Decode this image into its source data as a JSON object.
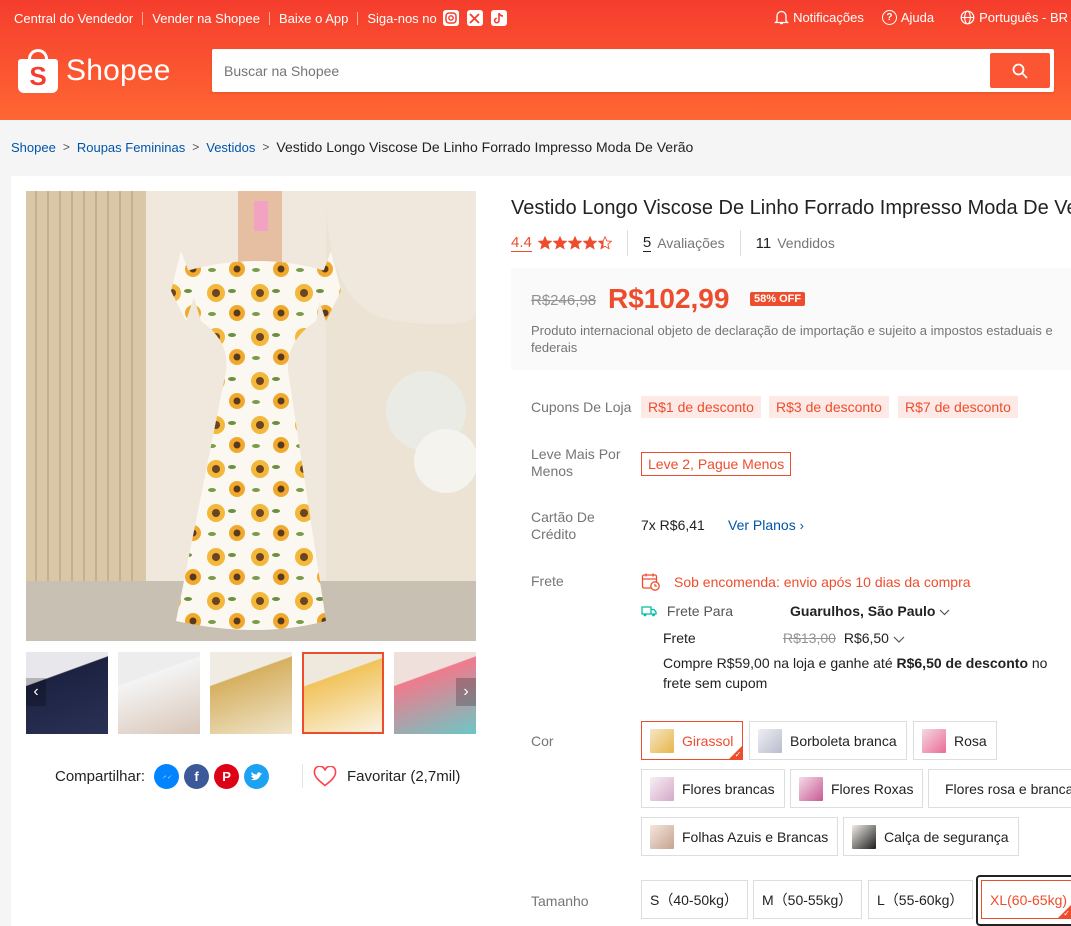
{
  "topbar": {
    "seller_center": "Central do Vendedor",
    "sell": "Vender na Shopee",
    "download": "Baixe o App",
    "follow": "Siga-nos no",
    "notifications": "Notificações",
    "help": "Ajuda",
    "language": "Português - BR"
  },
  "logo": {
    "mark": "S",
    "text": "Shopee"
  },
  "search": {
    "placeholder": "Buscar na Shopee"
  },
  "breadcrumb": {
    "items": [
      "Shopee",
      "Roupas Femininas",
      "Vestidos"
    ],
    "current": "Vestido Longo Viscose De Linho Forrado Impresso Moda De Verão"
  },
  "product": {
    "title": "Vestido Longo Viscose De Linho Forrado Impresso Moda De Verão",
    "rating": "4.4",
    "rating_value": 4.4,
    "reviews_count": "5",
    "reviews_label": "Avaliações",
    "sold_count": "11",
    "sold_label": "Vendidos",
    "old_price": "R$246,98",
    "price": "R$102,99",
    "discount": "58% OFF",
    "tax_note": "Produto internacional objeto de declaração de importação e sujeito a impostos estaduais e federais"
  },
  "coupons": {
    "label": "Cupons De Loja",
    "items": [
      "R$1 de desconto",
      "R$3 de desconto",
      "R$7 de desconto"
    ]
  },
  "promo": {
    "label": "Leve Mais Por Menos",
    "tag": "Leve 2, Pague Menos"
  },
  "credit": {
    "label": "Cartão De Crédito",
    "value": "7x R$6,41",
    "link": "Ver Planos"
  },
  "shipping": {
    "label": "Frete",
    "alert": "Sob encomenda: envio após 10 dias da compra",
    "to_label": "Frete Para",
    "to_value": "Guarulhos, São Paulo",
    "fee_label": "Frete",
    "fee_old": "R$13,00",
    "fee_new": "R$6,50",
    "note_pre": "Compre R$59,00 na loja e ganhe até ",
    "note_bold": "R$6,50 de desconto",
    "note_post": " no frete sem cupom"
  },
  "colors": {
    "label": "Cor",
    "options": [
      "Girassol",
      "Borboleta branca",
      "Rosa",
      "Flores brancas",
      "Flores Roxas",
      "Flores rosa e brancas",
      "Folhas Azuis e Brancas",
      "Calça de segurança"
    ],
    "selected": "Girassol"
  },
  "sizes": {
    "label": "Tamanho",
    "options": [
      "S（40-50kg）",
      "M（50-55kg）",
      "L（55-60kg）",
      "XL(60-65kg)"
    ],
    "selected": "XL(60-65kg)"
  },
  "share": {
    "label": "Compartilhar:"
  },
  "favorite": {
    "label": "Favoritar (2,7mil)"
  },
  "theme": {
    "brand": "#ee4d2d",
    "header": "#f53d2d",
    "link": "#0055aa"
  }
}
